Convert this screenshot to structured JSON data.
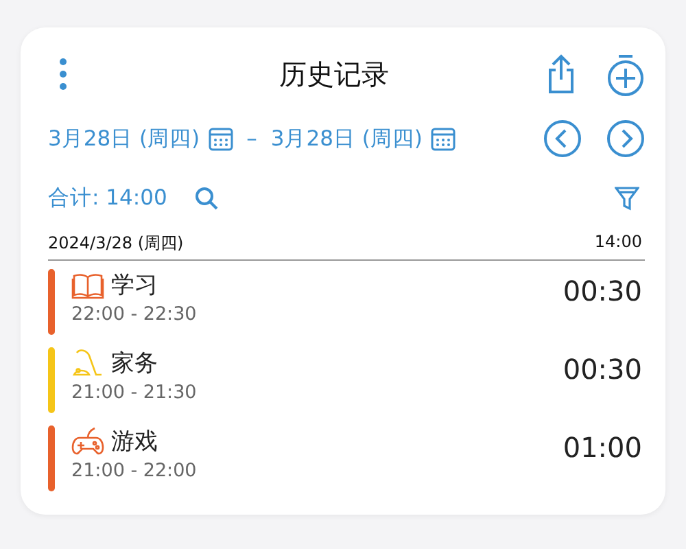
{
  "header": {
    "title": "历史记录"
  },
  "date_range": {
    "start": "3月28日 (周四)",
    "separator": "–",
    "end": "3月28日 (周四)"
  },
  "summary": {
    "total": "合计: 14:00"
  },
  "day": {
    "date": "2024/3/28 (周四)",
    "total": "14:00"
  },
  "entries": [
    {
      "kind": "book",
      "name": "学习",
      "time": "22:00 - 22:30",
      "duration": "00:30",
      "color": "#e8612c"
    },
    {
      "kind": "vacuum",
      "name": "家务",
      "time": "21:00 - 21:30",
      "duration": "00:30",
      "color": "#f5c518"
    },
    {
      "kind": "gamepad",
      "name": "游戏",
      "time": "21:00 - 22:00",
      "duration": "01:00",
      "color": "#e8612c"
    }
  ]
}
